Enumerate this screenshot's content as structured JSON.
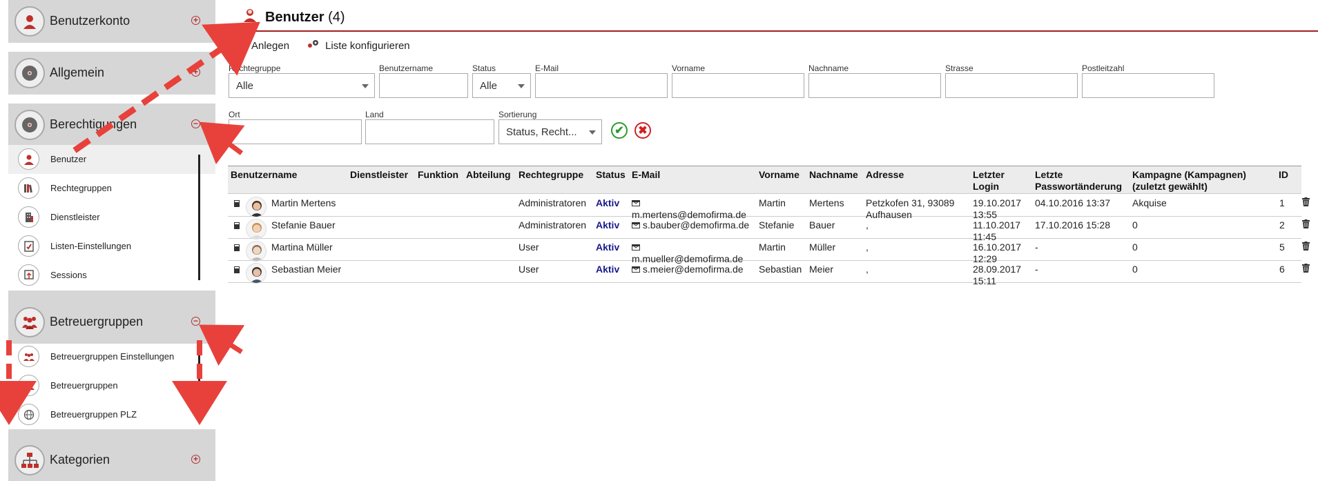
{
  "sidebar": {
    "sections": [
      {
        "title": "Benutzerkonto",
        "icon": "user-icon",
        "toggle": "+"
      },
      {
        "title": "Allgemein",
        "icon": "disc-icon",
        "toggle": "+"
      },
      {
        "title": "Berechtigungen",
        "icon": "disc-icon",
        "toggle": "−"
      },
      {
        "title": "Betreuergruppen",
        "icon": "group-icon",
        "toggle": "−"
      },
      {
        "title": "Kategorien",
        "icon": "hierarchy-icon",
        "toggle": "+"
      }
    ],
    "berechtigungen_items": [
      {
        "label": "Benutzer",
        "icon": "user-icon"
      },
      {
        "label": "Rechtegruppen",
        "icon": "books-icon"
      },
      {
        "label": "Dienstleister",
        "icon": "building-icon"
      },
      {
        "label": "Listen-Einstellungen",
        "icon": "list-settings-icon"
      },
      {
        "label": "Sessions",
        "icon": "sessions-icon"
      }
    ],
    "betreuergruppen_items": [
      {
        "label": "Betreuergruppen Einstellungen",
        "icon": "group-icon"
      },
      {
        "label": "Betreuergruppen",
        "icon": "group-icon"
      },
      {
        "label": "Betreuergruppen PLZ",
        "icon": "globe-icon"
      }
    ]
  },
  "header": {
    "title": "Benutzer",
    "count": "(4)"
  },
  "toolbar": {
    "create_label": "Anlegen",
    "configure_label": "Liste konfigurieren"
  },
  "filters": {
    "rechtegruppe": {
      "label": "Rechtegruppe",
      "value": "Alle"
    },
    "benutzername": {
      "label": "Benutzername",
      "value": ""
    },
    "status": {
      "label": "Status",
      "value": "Alle"
    },
    "email": {
      "label": "E-Mail",
      "value": ""
    },
    "vorname": {
      "label": "Vorname",
      "value": ""
    },
    "nachname": {
      "label": "Nachname",
      "value": ""
    },
    "strasse": {
      "label": "Strasse",
      "value": ""
    },
    "plz": {
      "label": "Postleitzahl",
      "value": ""
    },
    "ort": {
      "label": "Ort",
      "value": ""
    },
    "land": {
      "label": "Land",
      "value": ""
    },
    "sortierung": {
      "label": "Sortierung",
      "value": "Status, Recht..."
    }
  },
  "table": {
    "headers": {
      "benutzername": "Benutzername",
      "dienstleister": "Dienstleister",
      "funktion": "Funktion",
      "abteilung": "Abteilung",
      "rechtegruppe": "Rechtegruppe",
      "status": "Status",
      "email": "E-Mail",
      "vorname": "Vorname",
      "nachname": "Nachname",
      "adresse": "Adresse",
      "letzter_login_1": "Letzter",
      "letzter_login_2": "Login",
      "letzte_pw_1": "Letzte",
      "letzte_pw_2": "Passwortänderung",
      "kampagne_1": "Kampagne (Kampagnen)",
      "kampagne_2": "(zuletzt gewählt)",
      "id": "ID"
    },
    "rows": [
      {
        "name": "Martin Mertens",
        "rechtegruppe": "Administratoren",
        "status": "Aktiv",
        "email": "m.mertens@demofirma.de",
        "vorname": "Martin",
        "nachname": "Mertens",
        "adresse_1": "Petzkofen 31, 93089",
        "adresse_2": "Aufhausen",
        "login_1": "19.10.2017",
        "login_2": "13:55",
        "pw": "04.10.2016 13:37",
        "kampagne": "Akquise",
        "id": "1"
      },
      {
        "name": "Stefanie Bauer",
        "rechtegruppe": "Administratoren",
        "status": "Aktiv",
        "email": "s.bauber@demofirma.de",
        "vorname": "Stefanie",
        "nachname": "Bauer",
        "adresse_1": ",",
        "adresse_2": "",
        "login_1": "11.10.2017",
        "login_2": "11:45",
        "pw": "17.10.2016 15:28",
        "kampagne": "0",
        "id": "2"
      },
      {
        "name": "Martina Müller",
        "rechtegruppe": "User",
        "status": "Aktiv",
        "email": "m.mueller@demofirma.de",
        "vorname": "Martin",
        "nachname": "Müller",
        "adresse_1": ",",
        "adresse_2": "",
        "login_1": "16.10.2017",
        "login_2": "12:29",
        "pw": "-",
        "kampagne": "0",
        "id": "5"
      },
      {
        "name": "Sebastian Meier",
        "rechtegruppe": "User",
        "status": "Aktiv",
        "email": "s.meier@demofirma.de",
        "vorname": "Sebastian",
        "nachname": "Meier",
        "adresse_1": ",",
        "adresse_2": "",
        "login_1": "28.09.2017",
        "login_2": "15:11",
        "pw": "-",
        "kampagne": "0",
        "id": "6"
      }
    ]
  },
  "colors": {
    "accent": "#a02020",
    "link": "#1a1a8c",
    "annotation_arrow": "#e8413c",
    "sidebar_header": "#d6d6d6"
  }
}
